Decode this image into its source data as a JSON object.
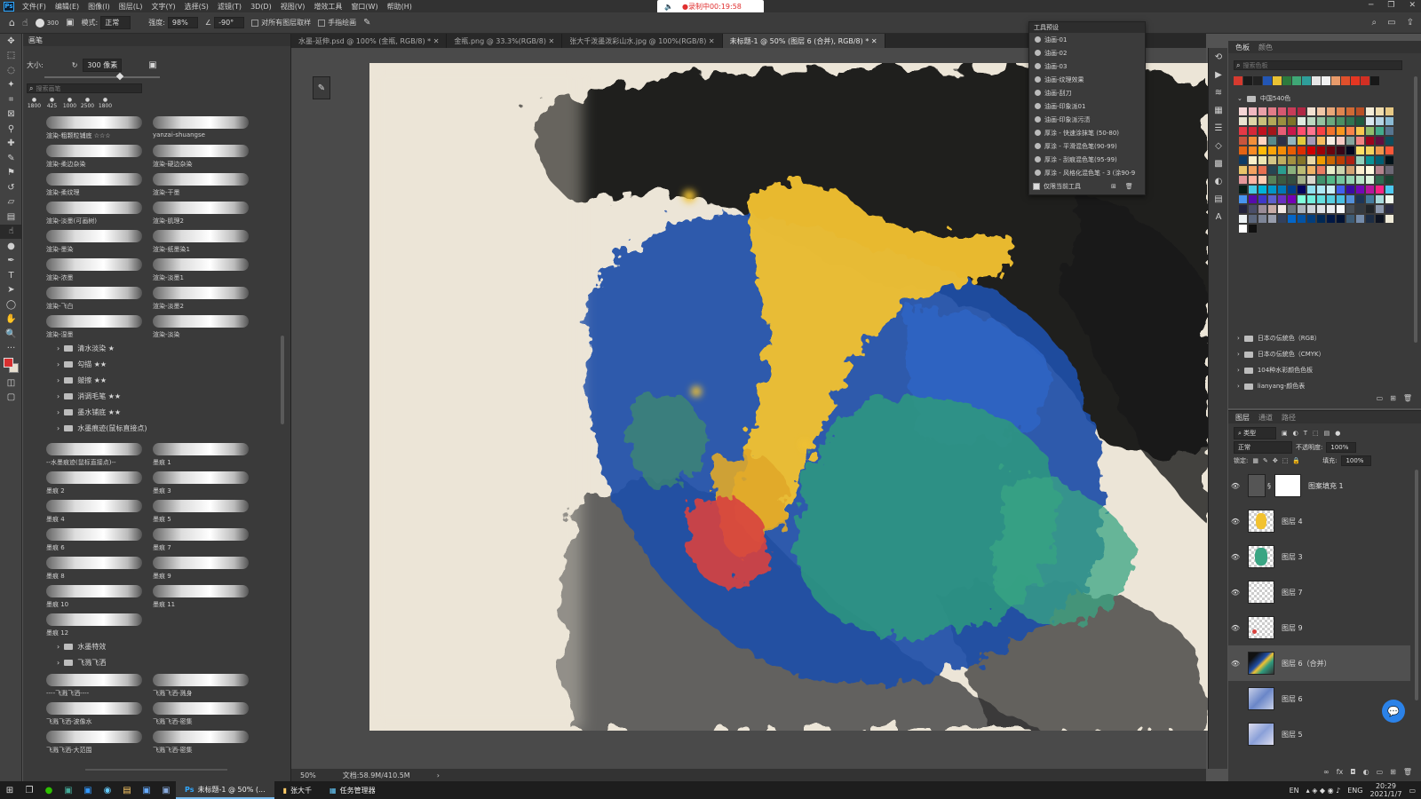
{
  "menubar": {
    "logo": "Ps",
    "items": [
      "文件(F)",
      "编辑(E)",
      "图像(I)",
      "图层(L)",
      "文字(Y)",
      "选择(S)",
      "滤镜(T)",
      "3D(D)",
      "视图(V)",
      "增效工具",
      "窗口(W)",
      "帮助(H)"
    ]
  },
  "recording": {
    "text": "●录制中00:19:58"
  },
  "options": {
    "mode_label": "模式:",
    "mode_value": "正常",
    "strength_label": "强度:",
    "strength_value": "98%",
    "angle_value": "-90°",
    "sample_all_label": "对所有图层取样",
    "finger_paint_label": "手指绘画",
    "size_value": "300"
  },
  "brushes": {
    "tab": "画笔",
    "size_label": "大小:",
    "size_value": "300 像素",
    "search_placeholder": "搜索画笔",
    "recent_sizes": [
      "1800",
      "425",
      "1000",
      "2500",
      "1800"
    ],
    "cells": [
      "渲染-粗颗粒铺底 ☆☆☆",
      "yanzai-shuangse",
      "渲染-柔边杂染",
      "渲染-硬边杂染",
      "渲染-柔纹理",
      "渲染-干墨",
      "渲染-淡墨(可画树)",
      "渲染-肌理2",
      "渲染-墨染",
      "渲染-纸墨染1",
      "渲染-浓墨",
      "渲染-淡墨1",
      "渲染-飞白",
      "渲染-淡墨2",
      "渲染-湿墨",
      "渲染-淡染"
    ],
    "folders": [
      "清水淡染 ★",
      "勾描 ★★",
      "皴擦 ★★",
      "消调毛笔 ★★",
      "墨水铺底 ★★",
      "水墨痕迹(鼠标直接点)"
    ],
    "ink_cells": [
      "--水墨痕迹(鼠标直接点)--",
      "墨痕 1",
      "墨痕 2",
      "墨痕 3",
      "墨痕 4",
      "墨痕 5",
      "墨痕 6",
      "墨痕 7",
      "墨痕 8",
      "墨痕 9",
      "墨痕 10",
      "墨痕 11",
      "墨痕 12"
    ],
    "folders2": [
      "水墨特效",
      "飞溅飞洒"
    ],
    "splash_cells": [
      "----飞溅飞洒----",
      "飞溅飞洒-溅身",
      "飞溅飞洒-波像水",
      "飞溅飞洒-密集",
      "飞溅飞洒-大范围",
      "飞溅飞洒-密集"
    ]
  },
  "doc_tabs": [
    "水墨-延伸.psd @ 100% (金瓶, RGB/8) *",
    "金瓶.png @ 33.3%(RGB/8)",
    "张大千泼墨泼彩山水.jpg @ 100%(RGB/8)",
    "未标题-1 @ 50% (图层 6 (合并), RGB/8) *"
  ],
  "status": {
    "zoom": "50%",
    "doc": "文档:58.9M/410.5M"
  },
  "tool_presets": {
    "title": "工具预设",
    "items": [
      "油画-01",
      "油画-02",
      "油画-03",
      "油画-纹理效果",
      "油画-刮刀",
      "油画-印象派01",
      "油画-印象派污渍",
      "厚涂 - 快速涂抹笔 (50-80)",
      "厚涂 - 平滑混色笔(90-99)",
      "厚涂 - 刮痕混色笔(95-99)",
      "厚涂 - 风格化混色笔 - 3 (涂90-9"
    ],
    "current_only": "仅限当前工具"
  },
  "swatches": {
    "tabs": [
      "色板",
      "颜色"
    ],
    "search_placeholder": "搜索色板",
    "top_colors": [
      "#d63a2f",
      "#1a1a1a",
      "#222222",
      "#2356b4",
      "#e8c133",
      "#2d7a3e",
      "#3fa776",
      "#2e9e9a",
      "#e6e6e6",
      "#f2f2f2",
      "#e89b6b",
      "#e0502c",
      "#e43622",
      "#d12f23",
      "#181818"
    ],
    "folder_china": "中国540色",
    "folders": [
      "日本の伝統色（RGB）",
      "日本の伝統色（CMYK）",
      "104种水彩颜色色板",
      "lianyang-颜色表"
    ],
    "grid_colors": [
      "#f5d6d6",
      "#f0b8c0",
      "#eaa0a8",
      "#e27c88",
      "#d65870",
      "#c83c58",
      "#b02844",
      "#f3e2d2",
      "#f1c7a7",
      "#e9a779",
      "#df8550",
      "#d06a35",
      "#b95026",
      "#f4ecd6",
      "#efdcae",
      "#e7c985",
      "#e9e5d2",
      "#ddd6a8",
      "#c9c07a",
      "#b3a958",
      "#9a8f3e",
      "#7d7428",
      "#dfece0",
      "#bcd9c1",
      "#94c2a0",
      "#6aa97e",
      "#4a8f63",
      "#307451",
      "#1f5a3e",
      "#d8e7ef",
      "#b5d3e3",
      "#8bbbd4",
      "#e63946",
      "#d62839",
      "#c1121f",
      "#a4161a",
      "#e85d75",
      "#c9184a",
      "#ff4d6d",
      "#ff758f",
      "#f94144",
      "#f3722c",
      "#f8961e",
      "#f9844a",
      "#f9c74f",
      "#90be6d",
      "#43aa8b",
      "#577590",
      "#c8553d",
      "#f28f3b",
      "#ffd5c2",
      "#588b8b",
      "#2d3047",
      "#93b7be",
      "#e0ca3c",
      "#a799b7",
      "#f6bd60",
      "#f7ede2",
      "#f5cac3",
      "#84a59d",
      "#f28482",
      "#9a031e",
      "#5f0f40",
      "#0f4c5c",
      "#e36414",
      "#fb8b24",
      "#ffba08",
      "#faa307",
      "#f48c06",
      "#e85d04",
      "#dc2f02",
      "#d00000",
      "#9d0208",
      "#6a040f",
      "#370617",
      "#03071e",
      "#ffe066",
      "#f4d35e",
      "#ee964b",
      "#f95738",
      "#0d3b66",
      "#faf0ca",
      "#ede7b1",
      "#d4c685",
      "#bfae5f",
      "#a39140",
      "#857529",
      "#e9d8a6",
      "#ee9b00",
      "#ca6702",
      "#bb3e03",
      "#ae2012",
      "#94d2bd",
      "#0a9396",
      "#005f73",
      "#001219",
      "#e9c46a",
      "#f4a261",
      "#e76f51",
      "#264653",
      "#2a9d8f",
      "#8ab17d",
      "#babb74",
      "#efb366",
      "#e97c61",
      "#e9edc9",
      "#ccd5ae",
      "#d4a373",
      "#faedcd",
      "#fefae0",
      "#b5838d",
      "#6d6875",
      "#e5989b",
      "#ffb4a2",
      "#ffcdb2",
      "#588157",
      "#3a5a40",
      "#344e41",
      "#a3b18a",
      "#dad7cd",
      "#40916c",
      "#52b788",
      "#74c69d",
      "#95d5b2",
      "#b7e4c7",
      "#d8f3dc",
      "#2d6a4f",
      "#1b4332",
      "#081c15",
      "#48cae4",
      "#00b4d8",
      "#0096c7",
      "#0077b6",
      "#023e8a",
      "#03045e",
      "#90e0ef",
      "#ade8f4",
      "#caf0f8",
      "#4361ee",
      "#3a0ca3",
      "#7209b7",
      "#b5179e",
      "#f72585",
      "#4cc9f0",
      "#4895ef",
      "#560bad",
      "#3f37c9",
      "#5e60ce",
      "#6930c3",
      "#7400b8",
      "#80ffdb",
      "#72efdd",
      "#64dfdf",
      "#56cfe1",
      "#48bfe3",
      "#5390d9",
      "#1d3557",
      "#457b9d",
      "#a8dadc",
      "#f1faee",
      "#22223b",
      "#4a4e69",
      "#9a8c98",
      "#c9ada7",
      "#f2e9e4",
      "#6c757d",
      "#adb5bd",
      "#ced4da",
      "#dee2e6",
      "#e9ecef",
      "#f8f9fa",
      "#495057",
      "#343a40",
      "#212529",
      "#8d99ae",
      "#2b2d42",
      "#edf2f4",
      "#5c677d",
      "#7d8597",
      "#979dac",
      "#33415c",
      "#0466c8",
      "#0353a4",
      "#023e7d",
      "#002855",
      "#001845",
      "#001233",
      "#3e5c76",
      "#748cab",
      "#1d2d44",
      "#0d1321",
      "#f0ebd8",
      "#ffffff",
      "#111111"
    ]
  },
  "layers": {
    "tabs": [
      "图层",
      "通道",
      "路径"
    ],
    "filter_label": "类型",
    "blend_mode": "正常",
    "opacity_label": "不透明度:",
    "opacity_value": "100%",
    "lock_label": "锁定:",
    "fill_label": "填充:",
    "fill_value": "100%",
    "items": [
      "图案填充 1",
      "图层 4",
      "图层 3",
      "图层 7",
      "图层 9",
      "图层 6（合并）",
      "图层 6",
      "图层 5"
    ]
  },
  "taskbar": {
    "apps": [
      "未标题-1 @ 50% (...",
      "张大千",
      "任务管理器"
    ],
    "tray_lang": "ENG",
    "time": "20:29",
    "date": "2021/1/7",
    "en": "EN"
  }
}
